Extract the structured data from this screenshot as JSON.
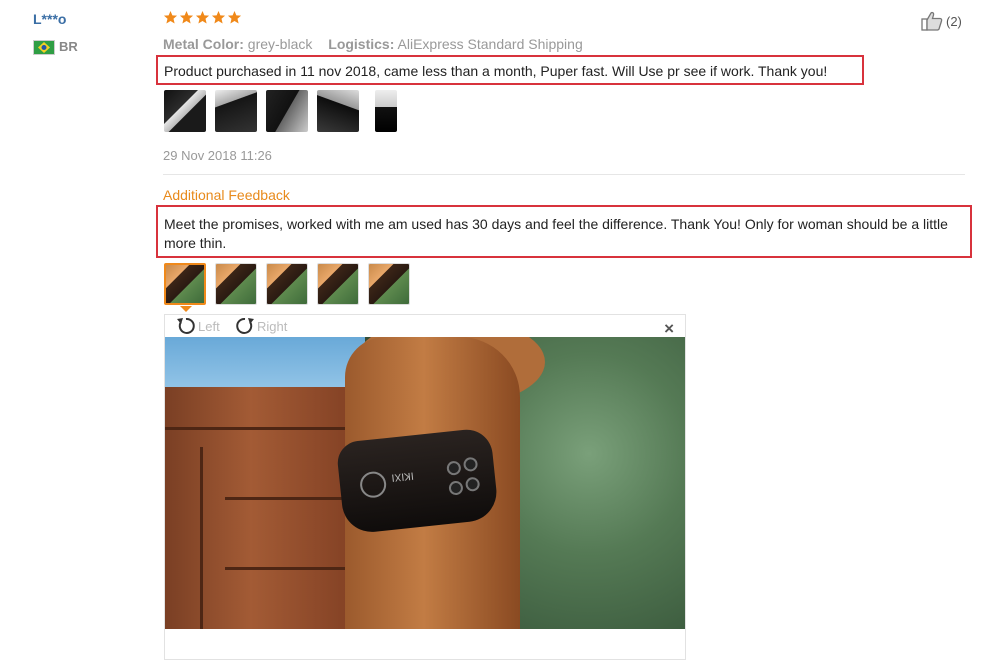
{
  "reviewer": {
    "name": "L***o",
    "country": "BR",
    "flag_colors": {
      "green": "#2f9e44",
      "yellow": "#f2d024",
      "blue": "#2456a6"
    }
  },
  "rating": {
    "stars": 5,
    "color": "#f0891a"
  },
  "helpful": {
    "icon": "thumbs-up-icon",
    "count": "(2)"
  },
  "attributes": {
    "color_label": "Metal Color:",
    "color_value": "grey-black",
    "logistics_label": "Logistics:",
    "logistics_value": "AliExpress Standard Shipping"
  },
  "review": {
    "text": "Product purchased in 11 nov 2018, came less than a month, Puper fast. Will Use pr see if work. Thank you!",
    "date": "29 Nov 2018 11:26"
  },
  "additional": {
    "title": "Additional Feedback",
    "text": "Meet the promises, worked with me am used has 30 days and feel the difference. Thank You! Only for woman should be a little more thin."
  },
  "viewer": {
    "rotate_left_label": "Left",
    "rotate_right_label": "Right",
    "close_symbol": "×",
    "band_text": "IKIXI"
  },
  "colors": {
    "highlight_border": "#d8323c",
    "accent_orange": "#e88a1b",
    "username_blue": "#3a6ea5"
  }
}
